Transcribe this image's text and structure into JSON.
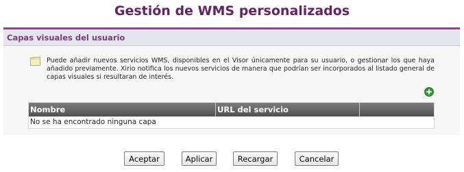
{
  "page": {
    "title": "Gestión de WMS personalizados"
  },
  "panel": {
    "header": "Capas visuales del usuario",
    "info": "Puede añadir nuevos servicios WMS, disponibles en el Visor únicamente para su usuario, o gestionar los que haya añadido previamente. Xirio notifica los nuevos servicios de manera que podrían ser incorporados al listado general de capas visuales si resultaran de interés.",
    "note_icon": "note-icon",
    "add_icon": "add-icon"
  },
  "table": {
    "columns": [
      "Nombre",
      "URL del servicio",
      ""
    ],
    "empty_message": "No se ha encontrado ninguna capa"
  },
  "buttons": {
    "accept": "Aceptar",
    "apply": "Aplicar",
    "reload": "Recargar",
    "cancel": "Cancelar"
  },
  "colors": {
    "title": "#662266",
    "accent": "#8a468a",
    "add_icon": "#2e9a2e"
  }
}
